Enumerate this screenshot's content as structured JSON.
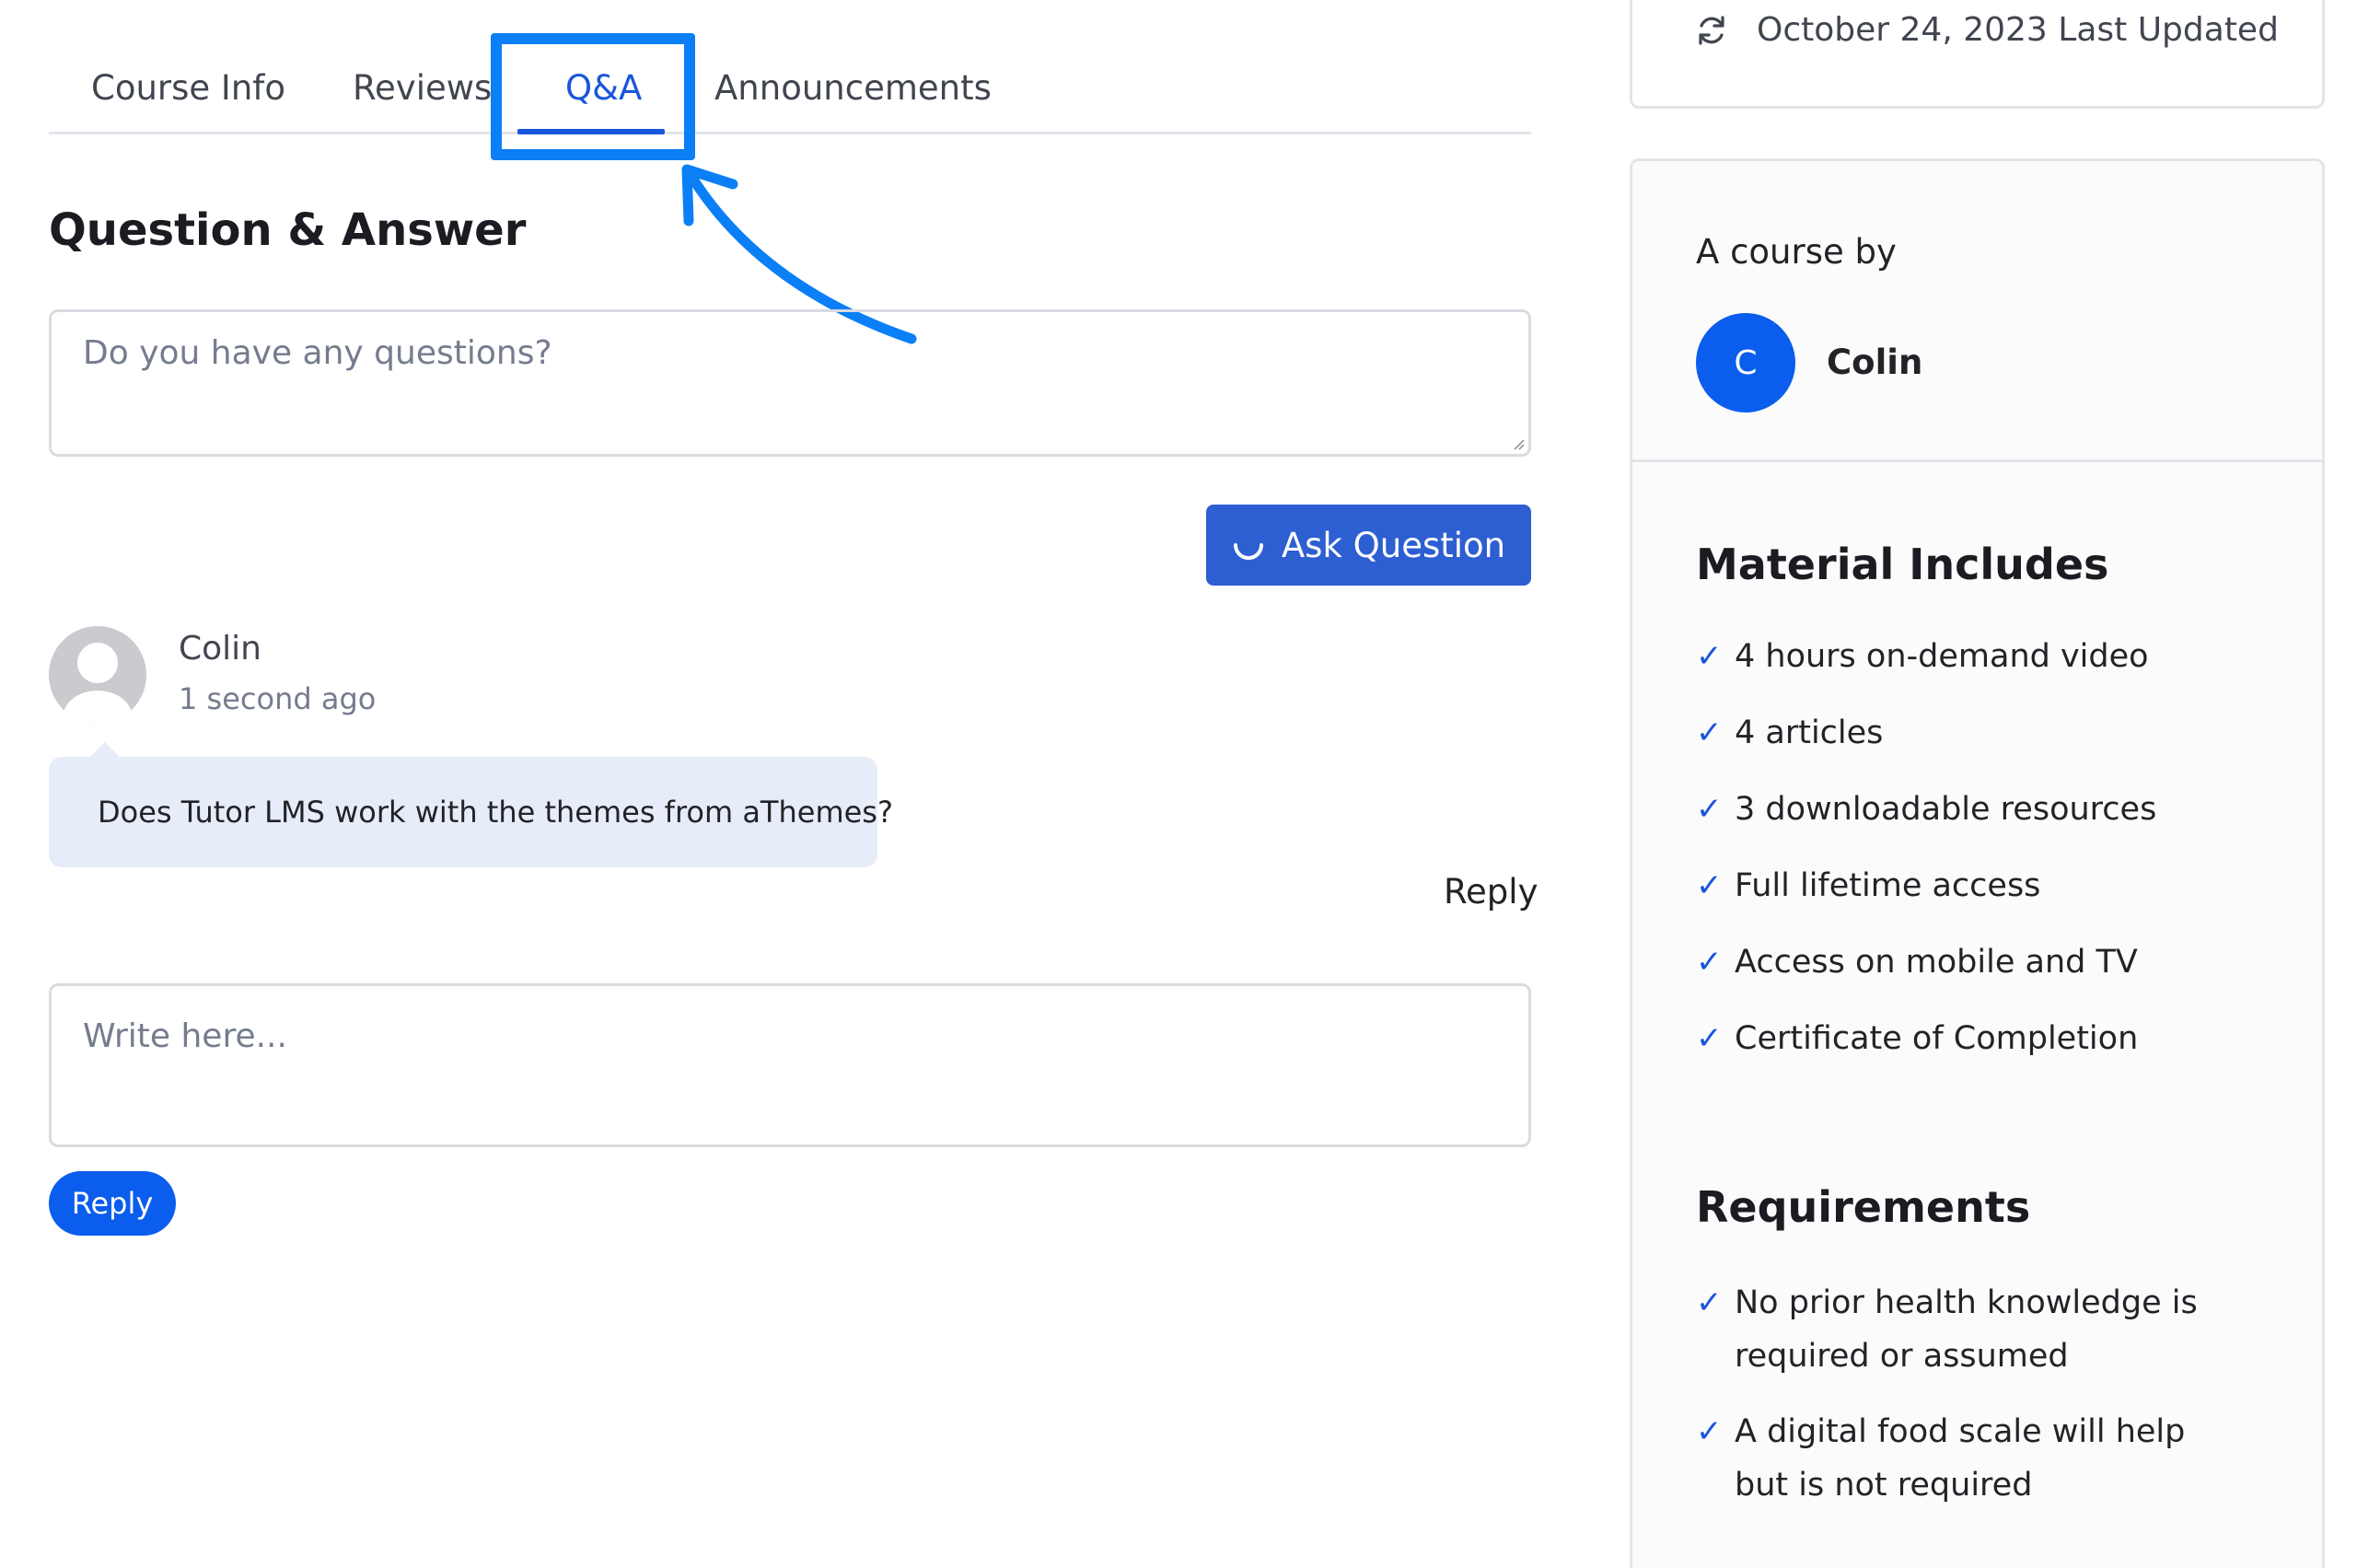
{
  "tabs": [
    {
      "label": "Course Info"
    },
    {
      "label": "Reviews"
    },
    {
      "label": "Q&A"
    },
    {
      "label": "Announcements"
    }
  ],
  "active_tab": "Q&A",
  "qa": {
    "title": "Question & Answer",
    "question_placeholder": "Do you have any questions?",
    "ask_label": "Ask Question",
    "author": "Colin",
    "time": "1 second ago",
    "question_text": "Does Tutor LMS work with the themes from aThemes?",
    "reply_link": "Reply",
    "reply_placeholder": "Write here...",
    "reply_button": "Reply"
  },
  "sidebar": {
    "last_updated": "October 24, 2023 Last Updated",
    "course_by": "A course by",
    "instructor_initial": "C",
    "instructor_name": "Colin",
    "material_title": "Material Includes",
    "materials": [
      "4 hours on-demand video",
      "4 articles",
      "3 downloadable resources",
      "Full lifetime access",
      "Access on mobile and TV",
      "Certificate of Completion"
    ],
    "requirements_title": "Requirements",
    "requirements": [
      "No prior health knowledge is required or assumed",
      "A digital food scale will help but is not required"
    ],
    "check_glyph": "✓"
  },
  "colors": {
    "accent": "#1a56db",
    "button": "#2d5fd2",
    "reply_button": "#0a5ded",
    "annotation": "#0b7ff5",
    "bubble": "#e6ecf8"
  }
}
